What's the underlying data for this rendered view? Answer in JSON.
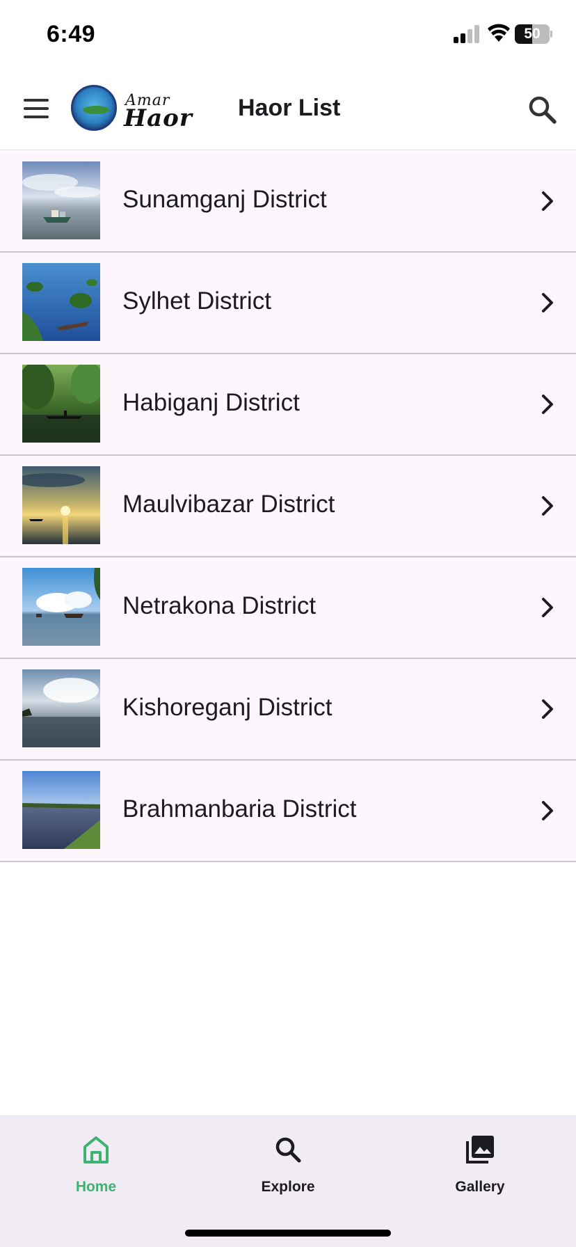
{
  "status_bar": {
    "time": "6:49",
    "battery_level": "50",
    "battery_fraction": 0.5
  },
  "app_bar": {
    "logo": {
      "line1": "Amar",
      "line2": "Haor"
    },
    "title": "Haor List",
    "menu_icon": "hamburger-menu-icon",
    "search_icon": "search-icon"
  },
  "districts": [
    {
      "label": "Sunamganj District",
      "thumbnail": "boat-under-cloudy-sky"
    },
    {
      "label": "Sylhet District",
      "thumbnail": "trees-in-flooded-water"
    },
    {
      "label": "Habiganj District",
      "thumbnail": "boat-in-green-forest"
    },
    {
      "label": "Maulvibazar District",
      "thumbnail": "sunset-over-water"
    },
    {
      "label": "Netrakona District",
      "thumbnail": "boats-under-blue-sky"
    },
    {
      "label": "Kishoreganj District",
      "thumbnail": "calm-lake-and-clouds"
    },
    {
      "label": "Brahmanbaria District",
      "thumbnail": "lake-shore-grass"
    }
  ],
  "bottom_nav": {
    "items": [
      {
        "label": "Home",
        "icon": "home-icon",
        "active": true
      },
      {
        "label": "Explore",
        "icon": "search-icon",
        "active": false
      },
      {
        "label": "Gallery",
        "icon": "gallery-icon",
        "active": false
      }
    ]
  },
  "colors": {
    "accent_active": "#3cb371",
    "list_background": "#fdf6fd",
    "nav_background": "#f1ecf4"
  }
}
